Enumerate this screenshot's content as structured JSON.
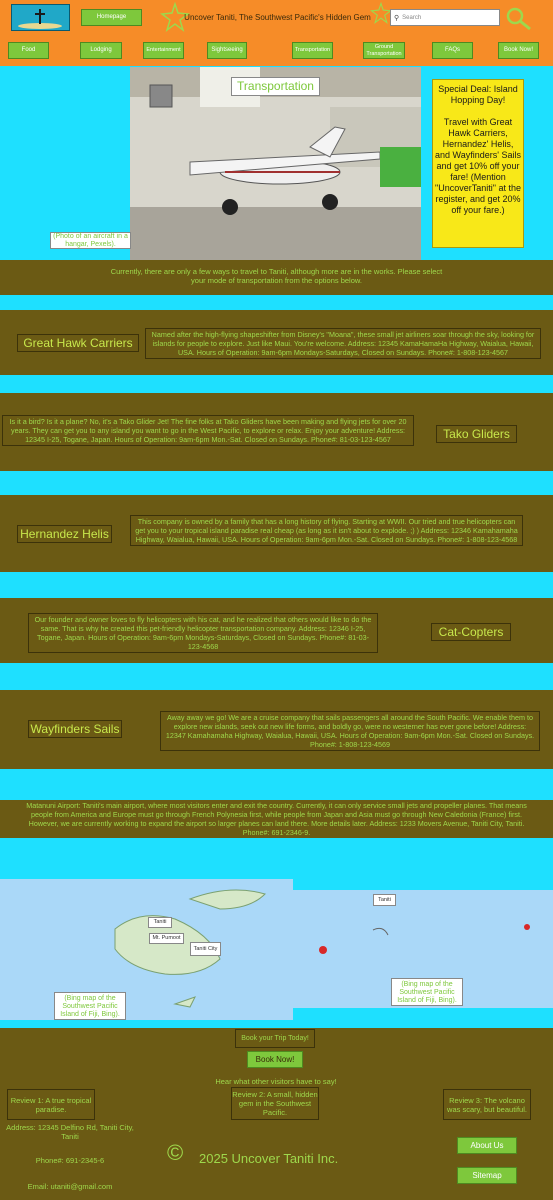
{
  "header": {
    "homepage_label": "Homepage",
    "site_title": "Uncover Taniti, The Southwest Pacific's Hidden Gem",
    "search_placeholder": "Search"
  },
  "nav": [
    "Food",
    "Lodging",
    "Entertainment",
    "Sightseeing",
    "Transportation",
    "Ground Transportation",
    "FAQs",
    "Book Now!"
  ],
  "hero": {
    "title": "Transportation",
    "caption": "(Photo of an aircraft in a hangar, Pexels).",
    "deal_title": "Special Deal: Island Hopping Day!",
    "deal_text": "Travel with Great Hawk Carriers, Hernandez' Helis, and Wayfinders' Sails and get 10% off your fare! (Mention \"UncoverTaniti\" at the register, and get 20% off your fare.)"
  },
  "intro": "Currently, there are only a few ways to travel to Taniti, although more are in the works. Please select your mode of transportation from the options below.",
  "companies": [
    {
      "name": "Great Hawk Carriers",
      "desc": "Named after the high-flying shapeshifter from Disney's \"Moana\", these small jet airliners soar through the sky, looking for islands for people to explore. Just like Maui. You're welcome. Address: 12345 KamaHamaHa Highway, Waialua, Hawaii, USA. Hours of Operation: 9am-6pm Mondays-Saturdays, Closed on Sundays. Phone#: 1-808-123-4567"
    },
    {
      "name": "Tako Gliders",
      "desc": "Is it a bird? Is it a plane? No, it's a Tako Glider Jet! The fine folks at Tako Gliders have been making and flying jets for over 20 years. They can get you to any island you want to go in the West Pacific, to explore or relax. Enjoy your adventure! Address: 12345 I-25, Togane, Japan. Hours of Operation: 9am-6pm Mon.-Sat. Closed on Sundays. Phone#: 81-03-123-4567"
    },
    {
      "name": "Hernandez Helis",
      "desc": "This company is owned by a family that has a long history of flying. Starting at WWII. Our tried and true helicopters can get you to your tropical island paradise real cheap (as long as it isn't about to explode. ;) ) Address: 12346 Kamahamaha Highway, Waialua, Hawaii, USA. Hours of Operation: 9am-6pm Mon.-Sat. Closed on Sundays. Phone#: 1-808-123-4568"
    },
    {
      "name": "Cat-Copters",
      "desc": "Our founder and owner loves to fly helicopters with his cat, and he realized that others would like to do the same. That is why he created this pet-friendly helicopter transportation company. Address: 12346 I-25, Togane, Japan. Hours of Operation: 9am-6pm Mondays-Saturdays, Closed on Sundays. Phone#: 81-03-123-4568"
    },
    {
      "name": "Wayfinders Sails",
      "desc": "Away away we go! We are a cruise company that sails passengers all around the South Pacific. We enable them to explore new islands, seek out new life forms, and boldly go, were no westerner has ever gone before! Address: 12347 Kamahamaha Highway, Waialua, Hawaii, USA. Hours of Operation: 9am-6pm Mon.-Sat. Closed on Sundays. Phone#: 1-808-123-4569"
    }
  ],
  "airport": "Matanuni Airport: Taniti's main airport, where most visitors enter and exit the country. Currently, it can only service small jets and propeller planes. That means people from America and Europe must go through French Polynesia first, while people from Japan and Asia must go through New Caledonia (France) first. However, we are currently working to expand the airport so larger planes can land there. More details later. Address: 1233 Movers Avenue, Taniti City, Taniti. Phone#: 691-2346-9.",
  "maps": {
    "left_labels": [
      "Taniti",
      "Mt. Pumoot",
      "Taniti City"
    ],
    "left_caption": "(Bing map of the Southwest Pacific Island of Fiji, Bing).",
    "right_label": "Taniti",
    "right_caption": "(Bing map of the Southwest Pacific Island of Fiji, Bing)."
  },
  "booking": {
    "label": "Book your Trip Today!",
    "button": "Book Now!"
  },
  "reviews": {
    "heading": "Hear what other visitors have to say!",
    "items": [
      "Review 1: A true tropical paradise.",
      "Review 2: A small, hidden gem in the Southwest Pacific.",
      "Review 3: The volcano was scary, but beautiful."
    ]
  },
  "footer": {
    "address": "Address: 12345 Delfino Rd, Taniti City, Taniti",
    "phone": "Phone#: 691-2345-6",
    "email": "Email: utaniti@gmail.com",
    "copyright_symbol": "©",
    "copyright": "2025 Uncover Taniti Inc.",
    "about": "About Us",
    "sitemap": "Sitemap"
  }
}
